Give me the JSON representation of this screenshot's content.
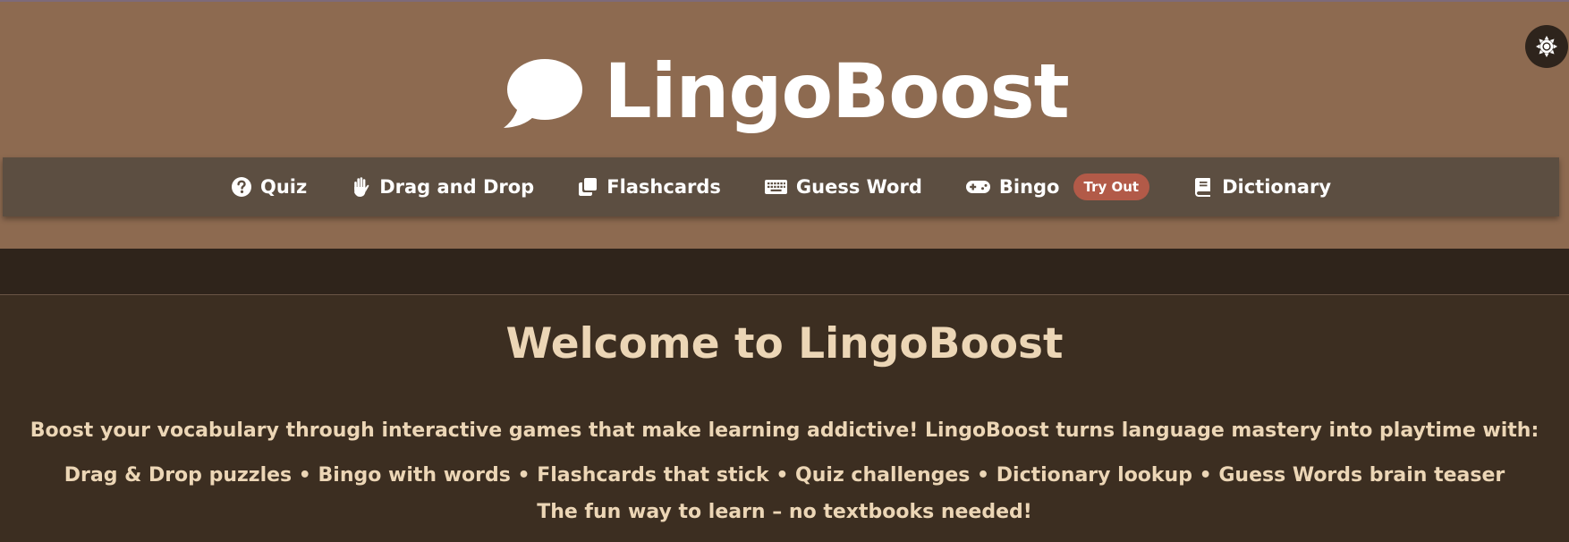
{
  "brand": {
    "name": "LingoBoost",
    "icon": "speech-bubble-icon",
    "header_color": "#8d6a50",
    "text_color": "#ffffff"
  },
  "theme_toggle": {
    "icon": "sun-icon"
  },
  "nav": {
    "background": "#5c4e41",
    "items": [
      {
        "label": "Quiz",
        "icon": "question-circle-icon"
      },
      {
        "label": "Drag and Drop",
        "icon": "hand-icon"
      },
      {
        "label": "Flashcards",
        "icon": "clone-icon"
      },
      {
        "label": "Guess Word",
        "icon": "keyboard-icon"
      },
      {
        "label": "Bingo",
        "icon": "gamepad-icon",
        "badge": "Try Out"
      },
      {
        "label": "Dictionary",
        "icon": "book-icon"
      }
    ],
    "badge_color": "#b25a48"
  },
  "main": {
    "title": "Welcome to LingoBoost",
    "description": "Boost your vocabulary through interactive games that make learning addictive! LingoBoost turns language mastery into playtime with: Drag & Drop puzzles • Bingo with words • Flashcards that stick • Quiz challenges • Dictionary lookup • Guess Words brain teaser",
    "tagline": "The fun way to learn – no textbooks needed!",
    "text_color": "#ecd6b6",
    "background": "#3c2e21"
  }
}
